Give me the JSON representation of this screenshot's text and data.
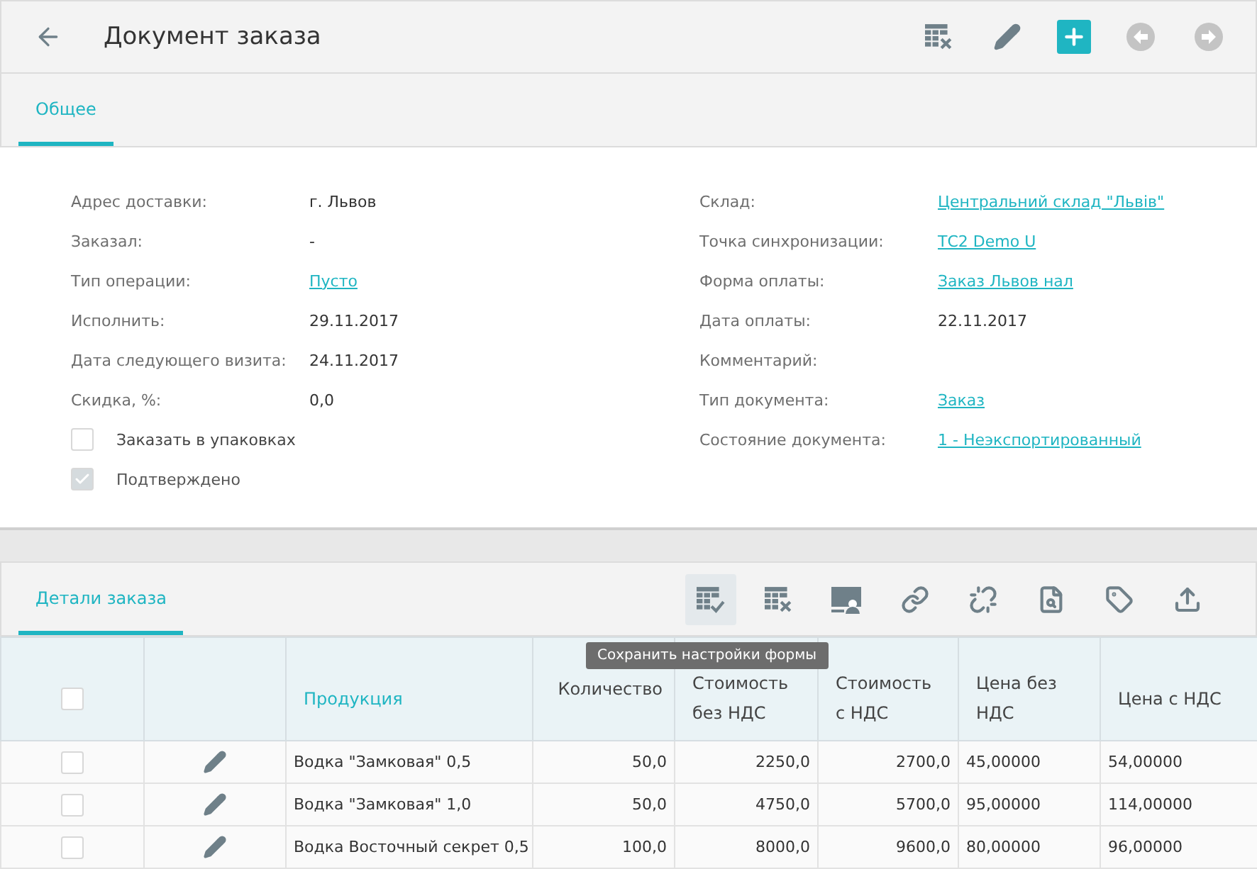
{
  "header": {
    "title": "Документ заказа"
  },
  "tabs": [
    {
      "label": "Общее",
      "selected": true
    }
  ],
  "fields_left": [
    {
      "label": "Адрес доставки:",
      "value": "г. Львов",
      "kind": "text"
    },
    {
      "label": "Заказал:",
      "value": "-",
      "kind": "text"
    },
    {
      "label": "Тип операции:",
      "value": "Пусто",
      "kind": "link"
    },
    {
      "label": "Исполнить:",
      "value": "29.11.2017",
      "kind": "text"
    },
    {
      "label": "Дата следующего визита:",
      "value": "24.11.2017",
      "kind": "text"
    },
    {
      "label": "Скидка, %:",
      "value": "0,0",
      "kind": "text"
    }
  ],
  "checkboxes": [
    {
      "label": "Заказать в упаковках",
      "checked": false,
      "disabled": false
    },
    {
      "label": "Подтверждено",
      "checked": true,
      "disabled": true
    }
  ],
  "fields_right": [
    {
      "label": "Склад:",
      "value": "Центральний склад \"Львів\"",
      "kind": "link"
    },
    {
      "label": "Точка синхронизации:",
      "value": "ТС2 Demo U",
      "kind": "link"
    },
    {
      "label": "Форма оплаты:",
      "value": "Заказ Львов нал",
      "kind": "link"
    },
    {
      "label": "Дата оплаты:",
      "value": "22.11.2017",
      "kind": "text"
    },
    {
      "label": "Комментарий:"
    },
    {
      "label": "Тип документа:",
      "value": "Заказ",
      "kind": "link"
    },
    {
      "label": "Состояние документа:",
      "value": "1 - Неэкспортированный",
      "kind": "link"
    }
  ],
  "details": {
    "tabs": [
      {
        "label": "Детали заказа",
        "selected": true
      }
    ],
    "tooltip": "Сохранить настройки формы",
    "select_all_checked": false,
    "columns": [
      {
        "label": "Продукция",
        "sorted": true,
        "kind": "text"
      },
      {
        "label": "Количество",
        "sorted": false,
        "kind": "quantity"
      },
      {
        "label": "Стоимость без НДС",
        "sorted": false,
        "kind": "amount"
      },
      {
        "label": "Стоимость с НДС",
        "sorted": false,
        "kind": "amount"
      },
      {
        "label": "Цена без НДС",
        "sorted": false,
        "kind": "text"
      },
      {
        "label": "Цена с НДС",
        "sorted": false,
        "kind": "text"
      }
    ],
    "rows": [
      {
        "checked": false,
        "cells": [
          "Водка \"Замковая\" 0,5",
          "50,0",
          "2250,0",
          "2700,0",
          "45,00000",
          "54,00000"
        ]
      },
      {
        "checked": false,
        "cells": [
          "Водка \"Замковая\" 1,0",
          "50,0",
          "4750,0",
          "5700,0",
          "95,00000",
          "114,00000"
        ]
      },
      {
        "checked": false,
        "cells": [
          "Водка Восточный секрет 0,5",
          "100,0",
          "8000,0",
          "9600,0",
          "80,00000",
          "96,00000"
        ]
      }
    ]
  }
}
